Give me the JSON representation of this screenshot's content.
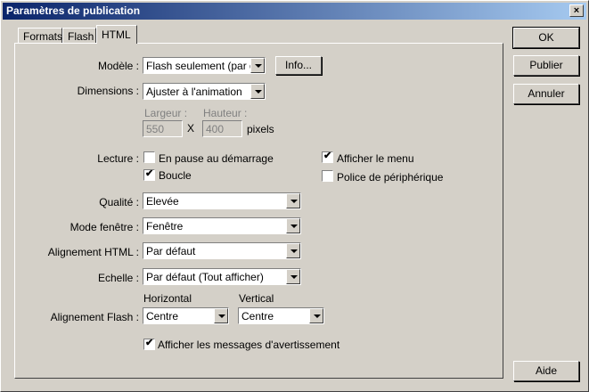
{
  "window": {
    "title": "Paramètres de publication",
    "close": "×"
  },
  "tabs": [
    {
      "label": "Formats"
    },
    {
      "label": "Flash"
    },
    {
      "label": "HTML"
    }
  ],
  "buttons": {
    "ok": "OK",
    "publish": "Publier",
    "cancel": "Annuler",
    "help": "Aide",
    "info": "Info..."
  },
  "form": {
    "template_label": "Modèle :",
    "template_value": "Flash seulement (par déf...",
    "dimensions_label": "Dimensions :",
    "dimensions_value": "Ajuster à l'animation",
    "width_label": "Largeur :",
    "width_value": "550",
    "height_label": "Hauteur :",
    "height_value": "400",
    "times": "X",
    "pixels": "pixels",
    "playback_label": "Lecture :",
    "pause_label": "En pause au démarrage",
    "pause_checked": false,
    "loop_label": "Boucle",
    "loop_checked": true,
    "menu_label": "Afficher le menu",
    "menu_checked": true,
    "device_font_label": "Police de périphérique",
    "device_font_checked": false,
    "quality_label": "Qualité :",
    "quality_value": "Elevée",
    "window_mode_label": "Mode fenêtre :",
    "window_mode_value": "Fenêtre",
    "html_align_label": "Alignement HTML :",
    "html_align_value": "Par défaut",
    "scale_label": "Echelle :",
    "scale_value": "Par défaut (Tout afficher)",
    "horizontal_label": "Horizontal",
    "vertical_label": "Vertical",
    "flash_align_label": "Alignement Flash :",
    "flash_align_h_value": "Centre",
    "flash_align_v_value": "Centre",
    "warnings_label": "Afficher les messages d'avertissement",
    "warnings_checked": true
  }
}
